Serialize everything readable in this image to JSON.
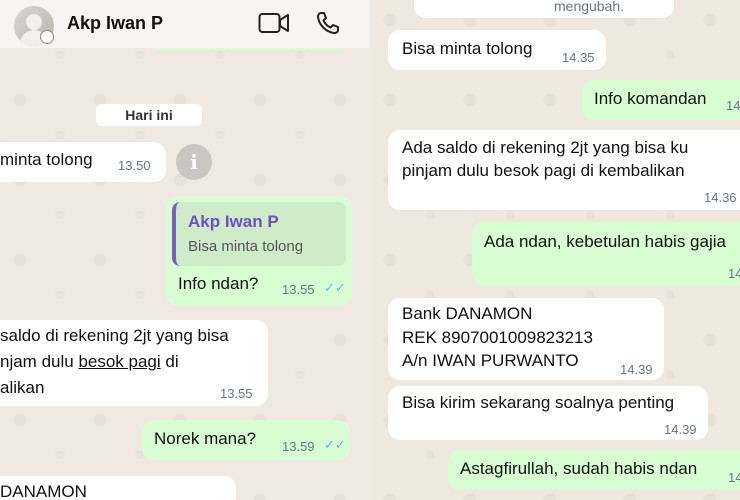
{
  "left": {
    "header": {
      "name": "Akp Iwan P"
    },
    "date_chip": "Hari ini",
    "msg1": {
      "text": "minta tolong",
      "time": "13.50"
    },
    "info_icon": "i",
    "msg2": {
      "quote_name": "Akp Iwan P",
      "quote_text": "Bisa minta tolong",
      "text": "Info ndan?",
      "time": "13.55"
    },
    "msg3": {
      "line1": "saldo di rekening 2jt yang bisa",
      "line2a": "njam dulu ",
      "line2b": "besok pagi",
      "line2c": " di",
      "line3": "alikan",
      "time": "13.55"
    },
    "msg4": {
      "text": "Norek mana?",
      "time": "13.59"
    },
    "msg5": {
      "text": "DANAMON"
    }
  },
  "right": {
    "top": {
      "text": "mengubah."
    },
    "msg1": {
      "text": "Bisa minta tolong",
      "time": "14.35"
    },
    "msg2": {
      "text": "Info komandan",
      "time": "14"
    },
    "msg3": {
      "line1": "Ada saldo di rekening 2jt yang bisa ku",
      "line2": "pinjam dulu besok pagi di kembalikan",
      "time": "14.36"
    },
    "msg4": {
      "text": "Ada ndan, kebetulan habis gajia",
      "time": "14"
    },
    "msg5": {
      "line1": "Bank DANAMON",
      "line2": "REK 8907001009823213",
      "line3": "A/n IWAN PURWANTO",
      "time": "14.39"
    },
    "msg6": {
      "text": "Bisa kirim sekarang soalnya penting",
      "time": "14.39"
    },
    "msg7": {
      "text": "Astagfirullah, sudah habis ndan",
      "time": "14"
    }
  },
  "colors": {
    "incoming": "#ffffff",
    "outgoing": "#d9fdd3",
    "quote_accent": "#7e5cc4",
    "read_ticks": "#53bdeb"
  },
  "icons": [
    "video-call-icon",
    "phone-call-icon",
    "info-icon",
    "double-check-icon"
  ]
}
